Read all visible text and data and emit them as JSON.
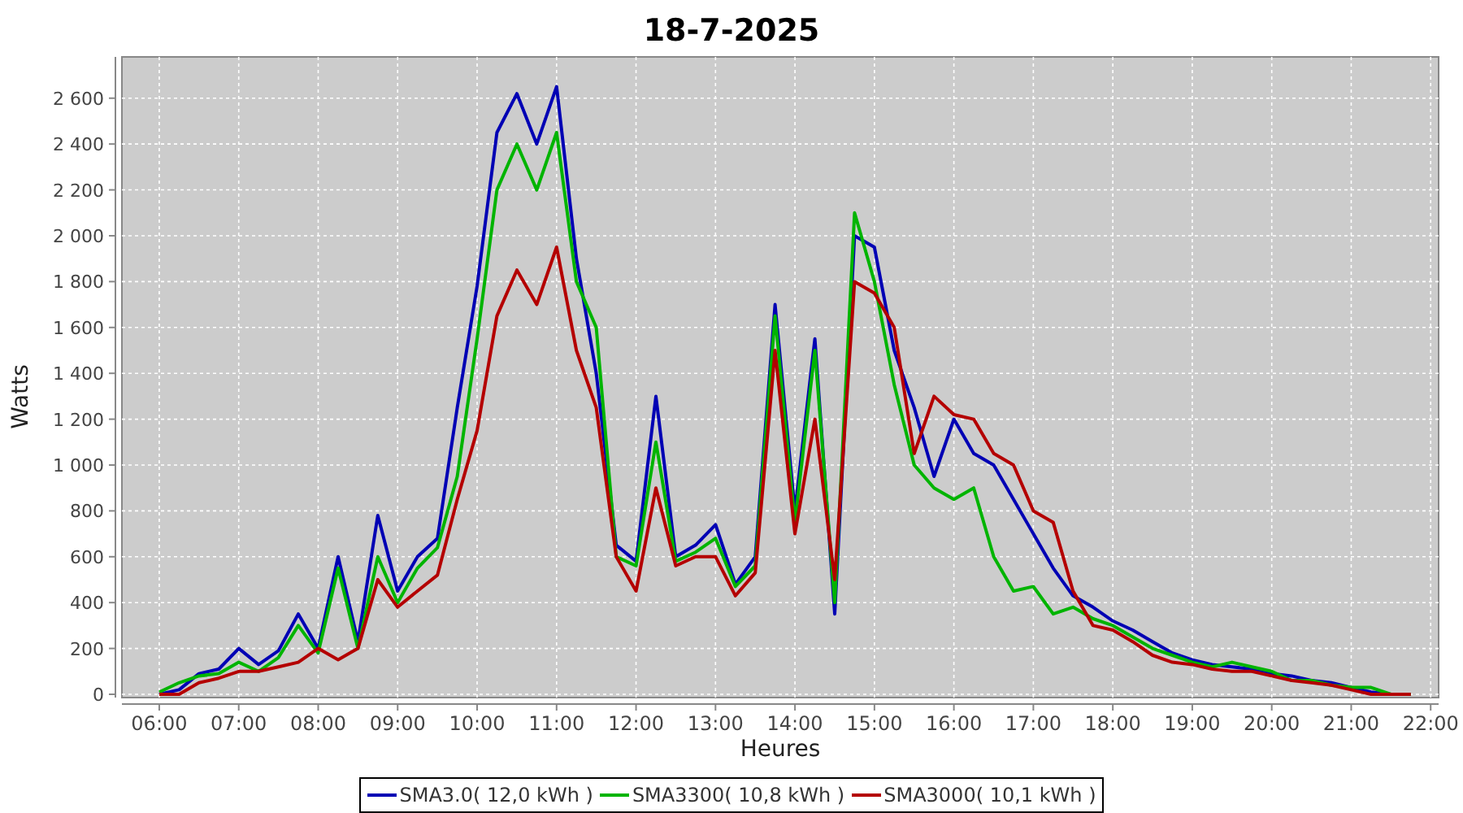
{
  "chart_data": {
    "type": "line",
    "title": "18-7-2025",
    "xlabel": "Heures",
    "ylabel": "Watts",
    "x": [
      6,
      6.25,
      6.5,
      6.75,
      7,
      7.25,
      7.5,
      7.75,
      8,
      8.25,
      8.5,
      8.75,
      9,
      9.25,
      9.5,
      9.75,
      10,
      10.25,
      10.5,
      10.75,
      11,
      11.25,
      11.5,
      11.75,
      12,
      12.25,
      12.5,
      12.75,
      13,
      13.25,
      13.5,
      13.75,
      14,
      14.25,
      14.5,
      14.75,
      15,
      15.25,
      15.5,
      15.75,
      16,
      16.25,
      16.5,
      16.75,
      17,
      17.25,
      17.5,
      17.75,
      18,
      18.25,
      18.5,
      18.75,
      19,
      19.25,
      19.5,
      19.75,
      20,
      20.25,
      20.5,
      20.75,
      21,
      21.25,
      21.5,
      21.75
    ],
    "series": [
      {
        "name": "SMA3.0( 12,0 kWh )",
        "color": "#0000b4",
        "values": [
          0,
          20,
          90,
          110,
          200,
          130,
          190,
          350,
          200,
          600,
          230,
          780,
          450,
          600,
          680,
          1250,
          1780,
          2450,
          2620,
          2400,
          2650,
          1900,
          1400,
          650,
          580,
          1300,
          600,
          650,
          740,
          480,
          600,
          1700,
          800,
          1550,
          350,
          2000,
          1950,
          1500,
          1250,
          950,
          1200,
          1050,
          1000,
          850,
          700,
          550,
          430,
          380,
          320,
          280,
          230,
          180,
          150,
          130,
          120,
          110,
          90,
          80,
          60,
          50,
          30,
          10,
          0,
          0
        ]
      },
      {
        "name": "SMA3300( 10,8 kWh )",
        "color": "#00b400",
        "values": [
          10,
          50,
          80,
          90,
          140,
          100,
          160,
          300,
          180,
          550,
          200,
          600,
          400,
          550,
          640,
          950,
          1550,
          2200,
          2400,
          2200,
          2450,
          1800,
          1600,
          600,
          560,
          1100,
          580,
          620,
          680,
          470,
          560,
          1650,
          750,
          1500,
          400,
          2100,
          1800,
          1350,
          1000,
          900,
          850,
          900,
          600,
          450,
          470,
          350,
          380,
          330,
          300,
          250,
          200,
          170,
          140,
          120,
          140,
          120,
          100,
          60,
          60,
          40,
          30,
          30,
          0,
          0
        ]
      },
      {
        "name": "SMA3000( 10,1 kWh )",
        "color": "#b40000",
        "values": [
          0,
          0,
          50,
          70,
          100,
          100,
          120,
          140,
          200,
          150,
          200,
          500,
          380,
          450,
          520,
          850,
          1150,
          1650,
          1850,
          1700,
          1950,
          1500,
          1250,
          600,
          450,
          900,
          560,
          600,
          600,
          430,
          530,
          1500,
          700,
          1200,
          500,
          1800,
          1750,
          1600,
          1050,
          1300,
          1220,
          1200,
          1050,
          1000,
          800,
          750,
          450,
          300,
          280,
          230,
          170,
          140,
          130,
          110,
          100,
          100,
          80,
          60,
          50,
          40,
          20,
          0,
          0,
          0
        ]
      }
    ],
    "grid": true,
    "xlim": [
      5.53,
      22.1
    ],
    "ylim": [
      0,
      2780
    ],
    "xticks": [
      {
        "value": 6,
        "label": "06:00"
      },
      {
        "value": 7,
        "label": "07:00"
      },
      {
        "value": 8,
        "label": "08:00"
      },
      {
        "value": 9,
        "label": "09:00"
      },
      {
        "value": 10,
        "label": "10:00"
      },
      {
        "value": 11,
        "label": "11:00"
      },
      {
        "value": 12,
        "label": "12:00"
      },
      {
        "value": 13,
        "label": "13:00"
      },
      {
        "value": 14,
        "label": "14:00"
      },
      {
        "value": 15,
        "label": "15:00"
      },
      {
        "value": 16,
        "label": "16:00"
      },
      {
        "value": 17,
        "label": "17:00"
      },
      {
        "value": 18,
        "label": "18:00"
      },
      {
        "value": 19,
        "label": "19:00"
      },
      {
        "value": 20,
        "label": "20:00"
      },
      {
        "value": 21,
        "label": "21:00"
      },
      {
        "value": 22,
        "label": "22:00"
      }
    ],
    "yticks": [
      {
        "value": 0,
        "label": "0"
      },
      {
        "value": 200,
        "label": "200"
      },
      {
        "value": 400,
        "label": "400"
      },
      {
        "value": 600,
        "label": "600"
      },
      {
        "value": 800,
        "label": "800"
      },
      {
        "value": 1000,
        "label": "1 000"
      },
      {
        "value": 1200,
        "label": "1 200"
      },
      {
        "value": 1400,
        "label": "1 400"
      },
      {
        "value": 1600,
        "label": "1 600"
      },
      {
        "value": 1800,
        "label": "1 800"
      },
      {
        "value": 2000,
        "label": "2 000"
      },
      {
        "value": 2200,
        "label": "2 200"
      },
      {
        "value": 2400,
        "label": "2 400"
      },
      {
        "value": 2600,
        "label": "2 600"
      }
    ]
  }
}
